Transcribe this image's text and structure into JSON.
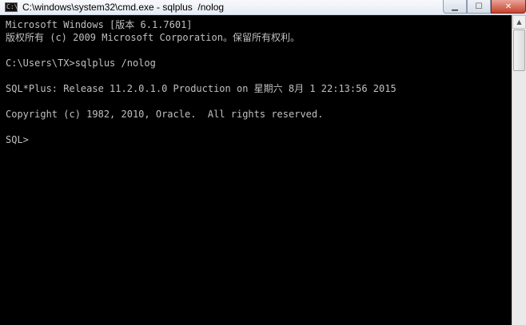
{
  "window": {
    "title": "C:\\windows\\system32\\cmd.exe - sqlplus  /nolog",
    "icon": "cmd-icon",
    "icon_text": "C:\\",
    "controls": {
      "minimize": "minimize-icon",
      "maximize": "maximize-icon",
      "close": "close-icon"
    }
  },
  "console": {
    "lines": [
      "Microsoft Windows [版本 6.1.7601]",
      "版权所有 (c) 2009 Microsoft Corporation。保留所有权利。",
      "",
      "C:\\Users\\TX>sqlplus /nolog",
      "",
      "SQL*Plus: Release 11.2.0.1.0 Production on 星期六 8月 1 22:13:56 2015",
      "",
      "Copyright (c) 1982, 2010, Oracle.  All rights reserved.",
      "",
      "SQL>"
    ]
  },
  "colors": {
    "console_bg": "#000000",
    "console_fg": "#c0c0c0",
    "close_button": "#c7422c"
  }
}
